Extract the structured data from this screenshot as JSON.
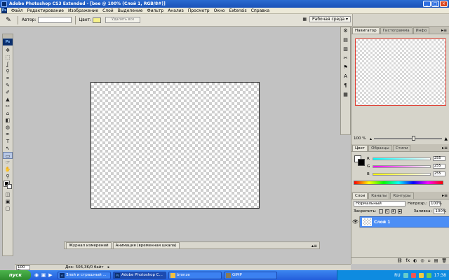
{
  "window": {
    "title": "Adobe Photoshop CS3 Extended - [bee @ 100% (Слой 1, RGB/8#)]",
    "buttons": [
      "_",
      "□",
      "×"
    ]
  },
  "menu": {
    "logo": "Ps",
    "items": [
      "Файл",
      "Редактирование",
      "Изображение",
      "Слой",
      "Выделение",
      "Фильтр",
      "Анализ",
      "Просмотр",
      "Окно",
      "Extensis",
      "Справка"
    ]
  },
  "options": {
    "author_label": "Автор:",
    "color_label": "Цвет:",
    "color_value": "#f6f18a",
    "delete_all": "Удалить все",
    "workspace": "Рабочая среда ▾"
  },
  "toolbox": {
    "logo": "Ps",
    "tools": [
      "✥",
      "⬚",
      "ʆ",
      "⚲",
      "⌗",
      "✎",
      "✐",
      "▲",
      "✂",
      "⌂",
      "◧",
      "◍",
      "✒",
      "T",
      "↖",
      "▭",
      "☞",
      "✋",
      "⚲"
    ],
    "extra": [
      "◫",
      "▣",
      "▢"
    ]
  },
  "panel_strip": {
    "icons": [
      "⚙",
      "▤",
      "▥",
      "✂",
      "⚑",
      "A",
      "¶",
      "▦"
    ]
  },
  "navigator": {
    "tabs": [
      "Навигатор",
      "Гистограмма",
      "Инфо"
    ],
    "zoom": "100 %",
    "zoom_level": 0.55
  },
  "color_panel": {
    "tabs": [
      "Цвет",
      "Образцы",
      "Стили"
    ],
    "channels": [
      {
        "name": "R",
        "value": "255",
        "color": "#ff6060"
      },
      {
        "name": "G",
        "value": "255",
        "color": "#60ff60"
      },
      {
        "name": "B",
        "value": "255",
        "color": "#6060ff"
      }
    ]
  },
  "layers_panel": {
    "tabs": [
      "Слои",
      "Каналы",
      "Контуры"
    ],
    "blend_mode": "Нормальный",
    "opacity_label": "Непрозр.:",
    "opacity": "100%",
    "lock_label": "Закрепить:",
    "fill_label": "Заливка:",
    "fill": "100%",
    "layer_name": "Слой 1",
    "footer_icons": [
      "⛓",
      "fx",
      "◐",
      "◎",
      "▫",
      "▤",
      "🗑"
    ]
  },
  "anim_strip": {
    "tabs": [
      "Журнал измерений",
      "Анимация (временная шкала)"
    ]
  },
  "status": {
    "zoom": "100 %",
    "doc": "Док: 506,3K/0 байт"
  },
  "taskbar": {
    "start": "пуск",
    "tasks": [
      {
        "label": "Злой и страшный ...",
        "active": false
      },
      {
        "label": "Adobe Photoshop C...",
        "active": true
      },
      {
        "label": "bronze",
        "active": false
      },
      {
        "label": "GIMP",
        "active": false
      }
    ],
    "lang": "RU",
    "time": "17:38"
  }
}
